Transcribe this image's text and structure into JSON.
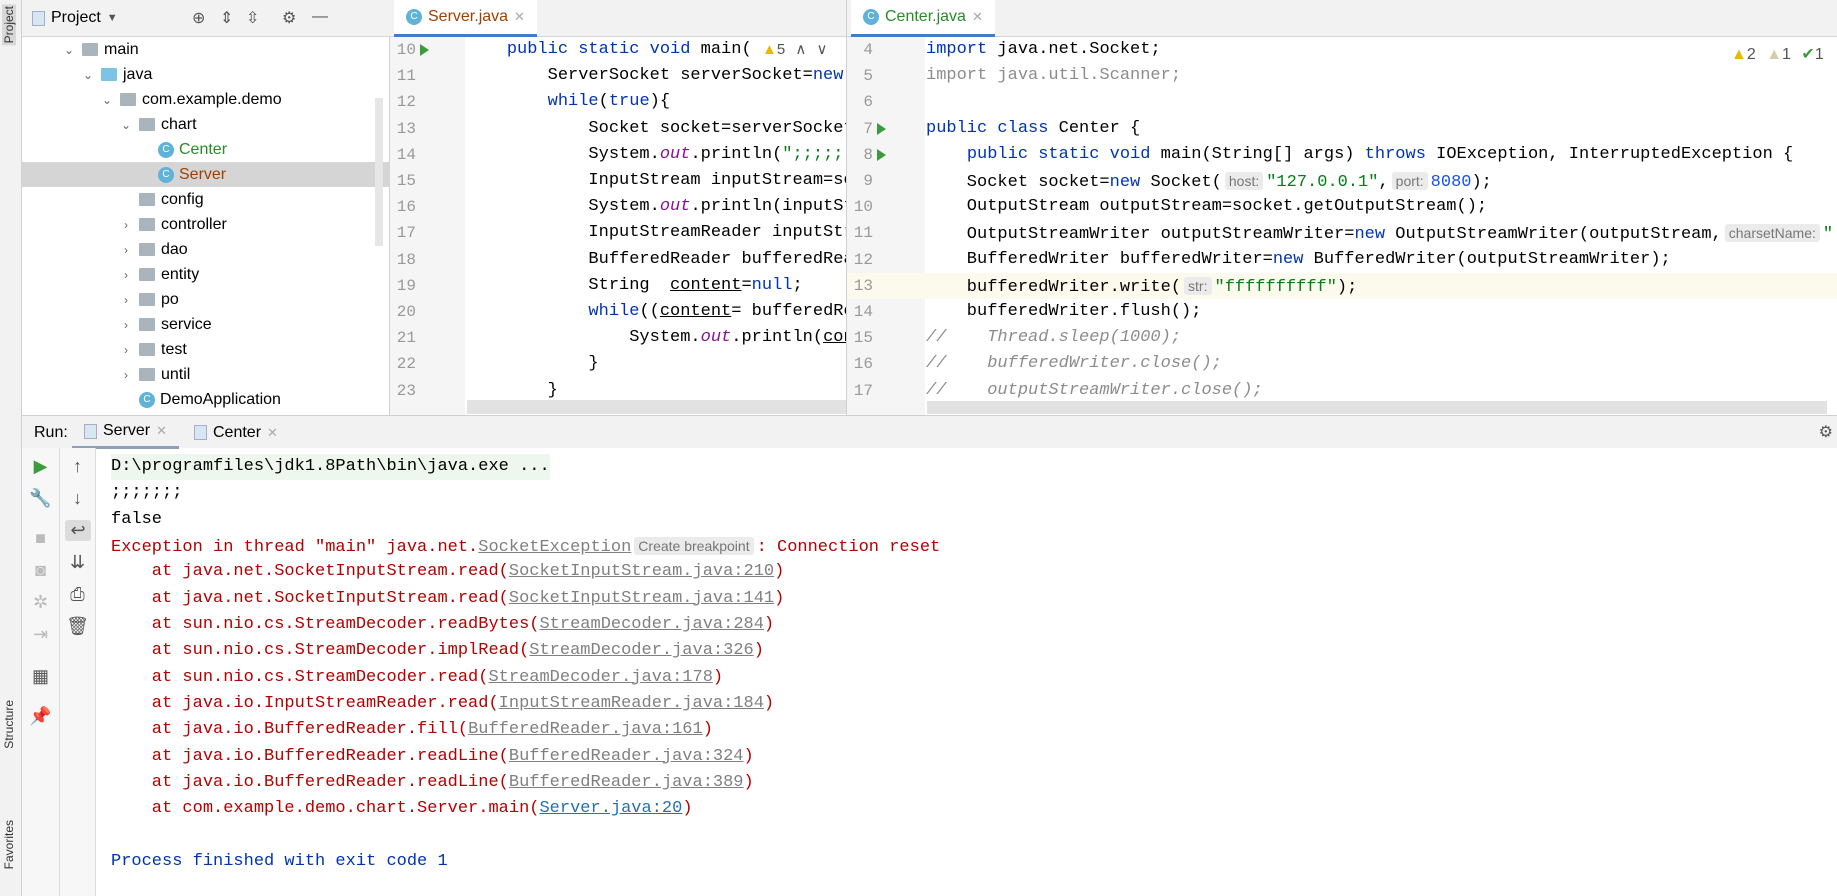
{
  "side_stripe": {
    "project": "Project",
    "structure": "Structure",
    "favorites": "Favorites"
  },
  "project": {
    "title": "Project",
    "tree": [
      {
        "label": "main",
        "depth": 0,
        "chev": "v",
        "icon": "folder"
      },
      {
        "label": "java",
        "depth": 1,
        "chev": "v",
        "icon": "folder-blue"
      },
      {
        "label": "com.example.demo",
        "depth": 2,
        "chev": "v",
        "icon": "package"
      },
      {
        "label": "chart",
        "depth": 3,
        "chev": "v",
        "icon": "package"
      },
      {
        "label": "Center",
        "depth": 4,
        "chev": "",
        "icon": "class",
        "color": "#2a8a2a"
      },
      {
        "label": "Server",
        "depth": 4,
        "chev": "",
        "icon": "class",
        "color": "#a04000",
        "selected": true
      },
      {
        "label": "config",
        "depth": 3,
        "chev": "",
        "icon": "package"
      },
      {
        "label": "controller",
        "depth": 3,
        "chev": ">",
        "icon": "package"
      },
      {
        "label": "dao",
        "depth": 3,
        "chev": ">",
        "icon": "package"
      },
      {
        "label": "entity",
        "depth": 3,
        "chev": ">",
        "icon": "package"
      },
      {
        "label": "po",
        "depth": 3,
        "chev": ">",
        "icon": "package"
      },
      {
        "label": "service",
        "depth": 3,
        "chev": ">",
        "icon": "package"
      },
      {
        "label": "test",
        "depth": 3,
        "chev": ">",
        "icon": "package"
      },
      {
        "label": "until",
        "depth": 3,
        "chev": ">",
        "icon": "package"
      },
      {
        "label": "DemoApplication",
        "depth": 3,
        "chev": "",
        "icon": "class-spring"
      }
    ]
  },
  "server_editor": {
    "tab": "Server.java",
    "inspection": "5",
    "lines": [
      {
        "n": "10",
        "segs": [
          [
            "",
            "    "
          ],
          [
            "kw",
            "public static void "
          ],
          [
            "",
            "main("
          ]
        ]
      },
      {
        "n": "11",
        "segs": [
          [
            "",
            "        ServerSocket serverSocket="
          ],
          [
            "kw",
            "new"
          ]
        ]
      },
      {
        "n": "12",
        "segs": [
          [
            "",
            "        "
          ],
          [
            "kw",
            "while"
          ],
          [
            "",
            "("
          ],
          [
            "kw",
            "true"
          ],
          [
            "",
            "){"
          ]
        ]
      },
      {
        "n": "13",
        "segs": [
          [
            "",
            "            Socket socket=serverSocket"
          ]
        ]
      },
      {
        "n": "14",
        "segs": [
          [
            "",
            "            System."
          ],
          [
            "fld",
            "out"
          ],
          [
            "",
            ".println("
          ],
          [
            "str",
            "\";;;;;;"
          ]
        ]
      },
      {
        "n": "15",
        "segs": [
          [
            "",
            "            InputStream inputStream=so"
          ]
        ]
      },
      {
        "n": "16",
        "segs": [
          [
            "",
            "            System."
          ],
          [
            "fld",
            "out"
          ],
          [
            "",
            ".println(inputSt"
          ]
        ]
      },
      {
        "n": "17",
        "segs": [
          [
            "",
            "            InputStreamReader inputStr"
          ]
        ]
      },
      {
        "n": "18",
        "segs": [
          [
            "",
            "            BufferedReader bufferedRea"
          ]
        ]
      },
      {
        "n": "19",
        "segs": [
          [
            "",
            "            String  "
          ],
          [
            "ul",
            "content"
          ],
          [
            "",
            "="
          ],
          [
            "kw",
            "null"
          ],
          [
            "",
            ";"
          ]
        ]
      },
      {
        "n": "20",
        "segs": [
          [
            "",
            "            "
          ],
          [
            "kw",
            "while"
          ],
          [
            "",
            "(("
          ],
          [
            "ul",
            "content"
          ],
          [
            "",
            "= bufferedRe"
          ]
        ]
      },
      {
        "n": "21",
        "segs": [
          [
            "",
            "                System."
          ],
          [
            "fld",
            "out"
          ],
          [
            "",
            ".println("
          ],
          [
            "ul",
            "con"
          ]
        ]
      },
      {
        "n": "22",
        "segs": [
          [
            "",
            "            }"
          ]
        ]
      },
      {
        "n": "23",
        "segs": [
          [
            "",
            "        }"
          ]
        ]
      }
    ]
  },
  "center_editor": {
    "tab": "Center.java",
    "warnings": "2",
    "weak_warnings": "1",
    "typos": "1",
    "lines": [
      {
        "n": "4",
        "segs": [
          [
            "kw",
            "import "
          ],
          [
            "",
            "java.net.Socket;"
          ]
        ]
      },
      {
        "n": "5",
        "segs": [
          [
            "gray",
            "import java.util.Scanner;"
          ]
        ]
      },
      {
        "n": "6",
        "segs": []
      },
      {
        "n": "7",
        "run": true,
        "segs": [
          [
            "kw",
            "public class "
          ],
          [
            "",
            "Center {"
          ]
        ]
      },
      {
        "n": "8",
        "run": true,
        "segs": [
          [
            "",
            "    "
          ],
          [
            "kw",
            "public static void "
          ],
          [
            "",
            "main(String[] args) "
          ],
          [
            "kw",
            "throws "
          ],
          [
            "",
            "IOException, InterruptedException {"
          ]
        ]
      },
      {
        "n": "9",
        "segs": [
          [
            "",
            "    Socket socket="
          ],
          [
            "kw",
            "new "
          ],
          [
            "",
            "Socket("
          ],
          [
            "hint",
            "host:"
          ],
          [
            "str",
            "\"127.0.0.1\""
          ],
          [
            "",
            ","
          ],
          [
            "hint",
            "port:"
          ],
          [
            "num",
            "8080"
          ],
          [
            "",
            ");"
          ]
        ]
      },
      {
        "n": "10",
        "segs": [
          [
            "",
            "    OutputStream outputStream=socket.getOutputStream();"
          ]
        ]
      },
      {
        "n": "11",
        "segs": [
          [
            "",
            "    OutputStreamWriter outputStreamWriter="
          ],
          [
            "kw",
            "new "
          ],
          [
            "",
            "OutputStreamWriter(outputStream,"
          ],
          [
            "hint",
            "charsetName:"
          ],
          [
            "str",
            "\""
          ]
        ]
      },
      {
        "n": "12",
        "segs": [
          [
            "",
            "    BufferedWriter bufferedWriter="
          ],
          [
            "kw",
            "new "
          ],
          [
            "",
            "BufferedWriter(outputStreamWriter);"
          ]
        ]
      },
      {
        "n": "13",
        "current": true,
        "segs": [
          [
            "",
            "    bufferedWriter.write("
          ],
          [
            "hint",
            "str:"
          ],
          [
            "str",
            "\"ffffffffff\""
          ],
          [
            "",
            ");"
          ]
        ]
      },
      {
        "n": "14",
        "segs": [
          [
            "",
            "    bufferedWriter.flush();"
          ]
        ]
      },
      {
        "n": "15",
        "segs": [
          [
            "cmt",
            "//    Thread.sleep(1000);"
          ]
        ]
      },
      {
        "n": "16",
        "segs": [
          [
            "cmt",
            "//    bufferedWriter.close();"
          ]
        ]
      },
      {
        "n": "17",
        "segs": [
          [
            "cmt",
            "//    outputStreamWriter.close();"
          ]
        ]
      }
    ]
  },
  "run": {
    "label": "Run:",
    "tabs": [
      "Server",
      "Center"
    ],
    "console": [
      {
        "segs": [
          [
            "",
            "D:\\programfiles\\jdk1.8Path\\bin\\java.exe ..."
          ]
        ],
        "cmd": true
      },
      {
        "segs": [
          [
            "",
            ";;;;;;;"
          ]
        ]
      },
      {
        "segs": [
          [
            "",
            "false"
          ]
        ]
      },
      {
        "segs": [
          [
            "err",
            "Exception in thread \"main\" java.net."
          ],
          [
            "lnk",
            "SocketException"
          ],
          [
            "hint",
            "Create breakpoint"
          ],
          [
            "err",
            ": Connection reset"
          ]
        ]
      },
      {
        "segs": [
          [
            "err",
            "    at java.net.SocketInputStream.read("
          ],
          [
            "lnk",
            "SocketInputStream.java:210"
          ],
          [
            "err",
            ")"
          ]
        ]
      },
      {
        "segs": [
          [
            "err",
            "    at java.net.SocketInputStream.read("
          ],
          [
            "lnk",
            "SocketInputStream.java:141"
          ],
          [
            "err",
            ")"
          ]
        ]
      },
      {
        "segs": [
          [
            "err",
            "    at sun.nio.cs.StreamDecoder.readBytes("
          ],
          [
            "lnk",
            "StreamDecoder.java:284"
          ],
          [
            "err",
            ")"
          ]
        ]
      },
      {
        "segs": [
          [
            "err",
            "    at sun.nio.cs.StreamDecoder.implRead("
          ],
          [
            "lnk",
            "StreamDecoder.java:326"
          ],
          [
            "err",
            ")"
          ]
        ]
      },
      {
        "segs": [
          [
            "err",
            "    at sun.nio.cs.StreamDecoder.read("
          ],
          [
            "lnk",
            "StreamDecoder.java:178"
          ],
          [
            "err",
            ")"
          ]
        ]
      },
      {
        "segs": [
          [
            "err",
            "    at java.io.InputStreamReader.read("
          ],
          [
            "lnk",
            "InputStreamReader.java:184"
          ],
          [
            "err",
            ")"
          ]
        ]
      },
      {
        "segs": [
          [
            "err",
            "    at java.io.BufferedReader.fill("
          ],
          [
            "lnk",
            "BufferedReader.java:161"
          ],
          [
            "err",
            ")"
          ]
        ]
      },
      {
        "segs": [
          [
            "err",
            "    at java.io.BufferedReader.readLine("
          ],
          [
            "lnk",
            "BufferedReader.java:324"
          ],
          [
            "err",
            ")"
          ]
        ]
      },
      {
        "segs": [
          [
            "err",
            "    at java.io.BufferedReader.readLine("
          ],
          [
            "lnk",
            "BufferedReader.java:389"
          ],
          [
            "err",
            ")"
          ]
        ]
      },
      {
        "segs": [
          [
            "err",
            "    at com.example.demo.chart.Server.main("
          ],
          [
            "lnkb",
            "Server.java:20"
          ],
          [
            "err",
            ")"
          ]
        ]
      },
      {
        "segs": []
      },
      {
        "segs": [
          [
            "kw",
            "Process finished with exit code 1"
          ]
        ]
      }
    ]
  }
}
